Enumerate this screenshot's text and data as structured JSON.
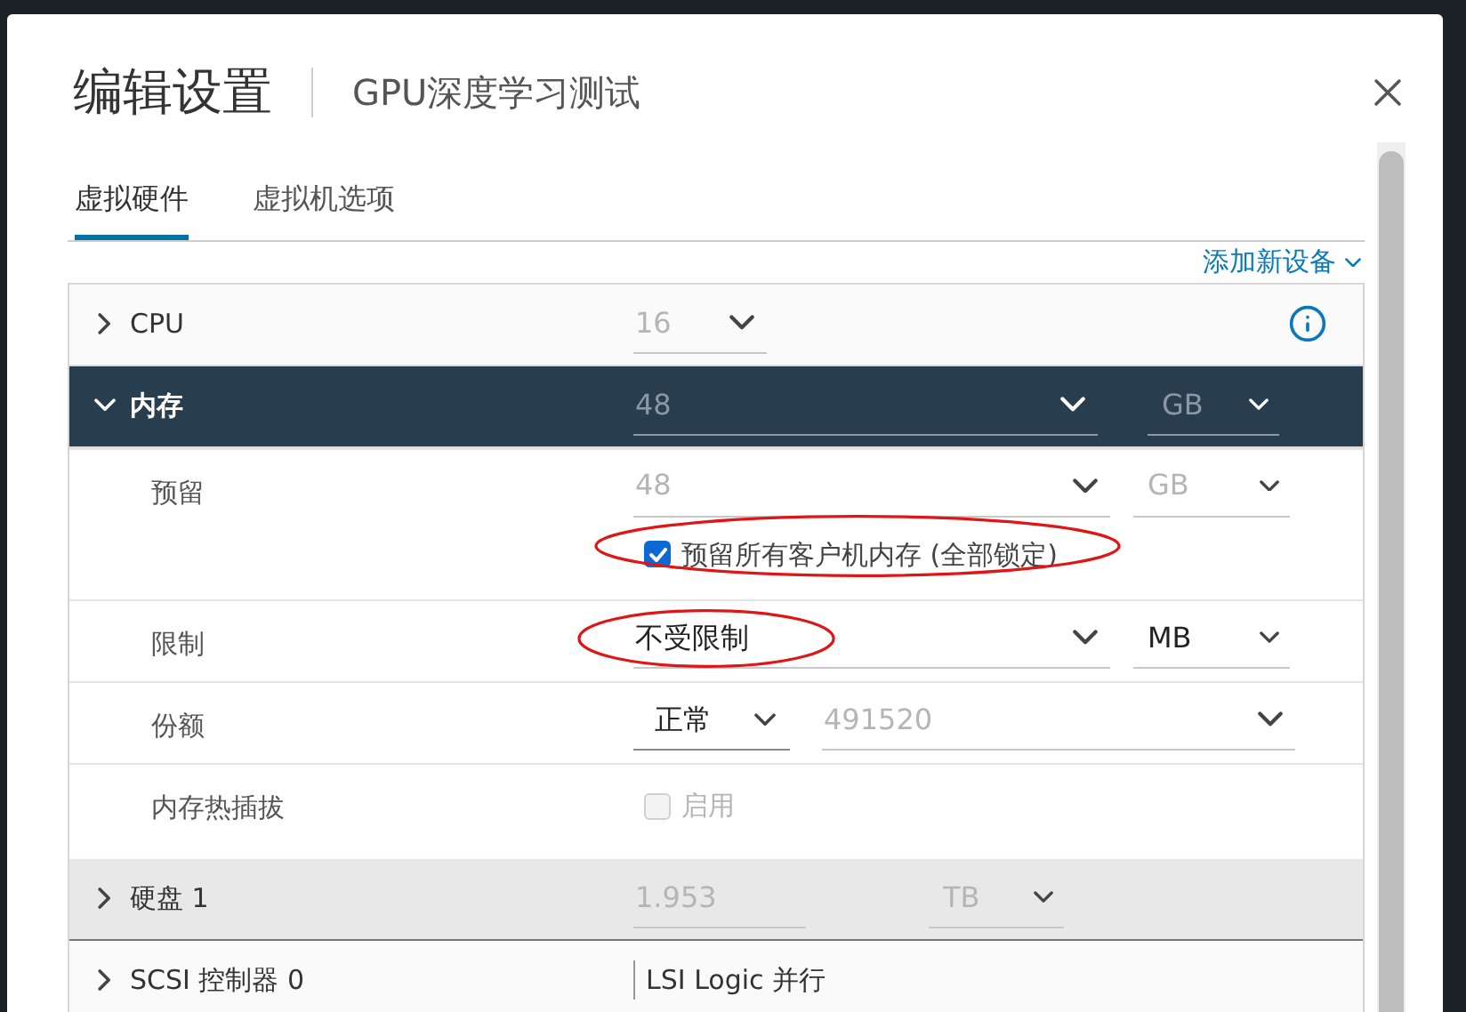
{
  "dialog": {
    "title": "编辑设置",
    "subtitle": "GPU深度学习测试"
  },
  "tabs": [
    {
      "label": "虚拟硬件",
      "selected": true
    },
    {
      "label": "虚拟机选项",
      "selected": false
    }
  ],
  "add_device": "添加新设备",
  "devices": [
    {
      "name": "CPU",
      "expanded": false,
      "selected": false,
      "info_icon": true,
      "field": {
        "kind": "select",
        "value": "16",
        "disabled": true
      }
    },
    {
      "name": "内存",
      "expanded": true,
      "selected": false,
      "field": {
        "kind": "combo",
        "value": "48",
        "disabled": true
      },
      "unit": {
        "value": "GB",
        "disabled": true
      },
      "settings": [
        {
          "label": "预留",
          "field": {
            "value": "48",
            "disabled": true
          },
          "unit": {
            "value": "GB",
            "disabled": true
          },
          "checkbox": {
            "label": "预留所有客户机内存 (全部锁定)",
            "checked": true,
            "circled": true
          }
        },
        {
          "label": "限制",
          "field": {
            "value": "不受限制",
            "disabled": false,
            "circled": true
          },
          "unit": {
            "value": "MB",
            "disabled": false
          }
        },
        {
          "label": "份额",
          "level_select": {
            "value": "正常"
          },
          "field": {
            "value": "491520",
            "disabled": true
          }
        },
        {
          "label": "内存热插拔",
          "checkbox": {
            "label": "启用",
            "checked": false,
            "disabled": true
          }
        }
      ]
    },
    {
      "name": "硬盘 1",
      "expanded": false,
      "selected": true,
      "field": {
        "kind": "text",
        "value": "1.953",
        "disabled": true
      },
      "unit": {
        "value": "TB",
        "disabled": true
      }
    },
    {
      "name": "SCSI 控制器 0",
      "expanded": false,
      "selected": false,
      "text": "LSI Logic 并行"
    }
  ]
}
